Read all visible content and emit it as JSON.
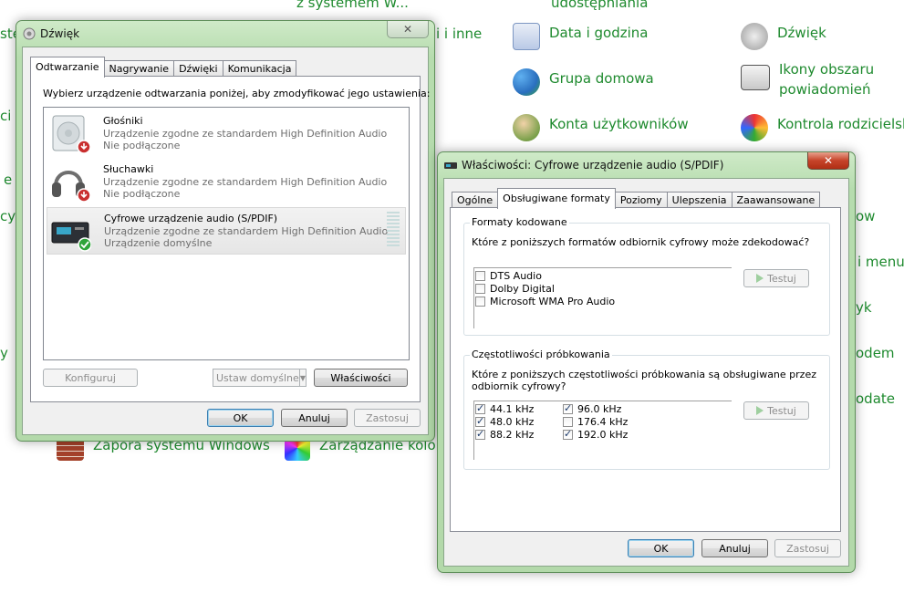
{
  "control_panel": {
    "items": [
      {
        "label": "Data i godzina",
        "icon": "calendar-icon"
      },
      {
        "label": "Dźwięk",
        "icon": "speaker-icon"
      },
      {
        "label": "Grupa domowa",
        "icon": "homegroup-icon"
      },
      {
        "label": "Ikony obszaru",
        "label2": "powiadomień",
        "icon": "notification-area-icon"
      },
      {
        "label": "Konta użytkowników",
        "icon": "user-accounts-icon"
      },
      {
        "label": "Kontrola rodzicielsk",
        "icon": "parental-controls-icon"
      },
      {
        "label": "Zapora systemu Windows",
        "icon": "firewall-icon"
      },
      {
        "label": "Zarządzanie kolor",
        "icon": "color-management-icon"
      }
    ],
    "fragments": [
      "z systemem W...",
      "i i inne",
      "udostępniania",
      "ow",
      "i menu",
      "yk",
      "odem",
      "odate",
      "stę",
      "ci i",
      "e",
      "cy",
      "y"
    ]
  },
  "sound_window": {
    "title": "Dźwięk",
    "close": "✕",
    "tabs": [
      "Odtwarzanie",
      "Nagrywanie",
      "Dźwięki",
      "Komunikacja"
    ],
    "instruction": "Wybierz urządzenie odtwarzania poniżej, aby zmodyfikować jego ustawienia:",
    "devices": [
      {
        "name": "Głośniki",
        "line1": "Urządzenie zgodne ze standardem High Definition Audio",
        "line2": "Nie podłączone"
      },
      {
        "name": "Słuchawki",
        "line1": "Urządzenie zgodne ze standardem High Definition Audio",
        "line2": "Nie podłączone"
      },
      {
        "name": "Cyfrowe urządzenie audio (S/PDIF)",
        "line1": "Urządzenie zgodne ze standardem High Definition Audio",
        "line2": "Urządzenie domyślne"
      }
    ],
    "configure": "Konfiguruj",
    "set_default": "Ustaw domyślne",
    "properties": "Właściwości",
    "ok": "OK",
    "cancel": "Anuluj",
    "apply": "Zastosuj"
  },
  "props_window": {
    "title": "Właściwości: Cyfrowe urządzenie audio (S/PDIF)",
    "close": "✕",
    "tabs": [
      "Ogólne",
      "Obsługiwane formaty",
      "Poziomy",
      "Ulepszenia",
      "Zaawansowane"
    ],
    "encoded": {
      "title": "Formaty kodowane",
      "question": "Które z poniższych formatów odbiornik cyfrowy może zdekodować?",
      "formats": [
        {
          "label": "DTS Audio",
          "checked": false
        },
        {
          "label": "Dolby Digital",
          "checked": false
        },
        {
          "label": "Microsoft WMA Pro Audio",
          "checked": false
        }
      ],
      "test": "Testuj"
    },
    "sample_rates": {
      "title": "Częstotliwości próbkowania",
      "question1": "Które z poniższych częstotliwości próbkowania są obsługiwane przez",
      "question2": "odbiornik cyfrowy?",
      "rates": [
        {
          "label": "44.1 kHz",
          "checked": true
        },
        {
          "label": "48.0 kHz",
          "checked": true
        },
        {
          "label": "88.2 kHz",
          "checked": true
        },
        {
          "label": "96.0 kHz",
          "checked": true
        },
        {
          "label": "176.4 kHz",
          "checked": false
        },
        {
          "label": "192.0 kHz",
          "checked": true
        }
      ],
      "test": "Testuj"
    },
    "ok": "OK",
    "cancel": "Anuluj",
    "apply": "Zastosuj"
  },
  "colors": {
    "link_green": "#1e8a2e",
    "aero_green": "#b6dcae",
    "default_blue": "#3c7fb1"
  }
}
